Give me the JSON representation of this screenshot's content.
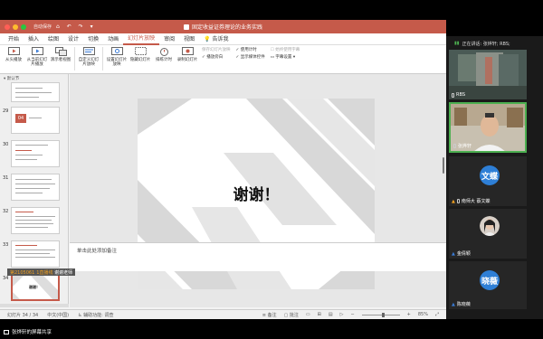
{
  "app": {
    "autosave_label": "自动保存",
    "doc_title": "固定收益证券理论的业务实践"
  },
  "menu": [
    "开始",
    "插入",
    "绘图",
    "设计",
    "切换",
    "动画",
    "幻灯片放映",
    "审阅",
    "视图",
    "告诉我"
  ],
  "ribbon": {
    "buttons": [
      "从头播放",
      "从当前幻灯片播放",
      "演示者视图",
      "自定义幻灯片放映",
      "设置幻灯片放映",
      "隐藏幻灯片",
      "排练计时",
      "录制幻灯片"
    ],
    "options_col1": [
      "保存幻灯片放映",
      "播放旁白"
    ],
    "options_col2": [
      "使用计时",
      "显示媒体控件"
    ],
    "options_col3": [
      "始终使用字幕",
      "字幕设置"
    ]
  },
  "thumbnails": {
    "section": "默认节",
    "numbers": [
      "29",
      "30",
      "31",
      "32",
      "33",
      "34"
    ],
    "label_29": "04"
  },
  "slide": {
    "title": "谢谢！"
  },
  "speaker_tip": {
    "prefix": "第2105061",
    "text": "1直播线",
    "name": "谢谢老师"
  },
  "notes": {
    "placeholder": "单击此处添加备注"
  },
  "status": {
    "slide_pos": "幻灯片 34 / 34",
    "language": "中文(中国)",
    "accessibility": "辅助功能: 调查",
    "notes_btn": "备注",
    "comments_btn": "批注",
    "zoom": "85%"
  },
  "meeting": {
    "speaking_label": "正在讲话: 张烨轩; RBS;",
    "participants": [
      {
        "name": "RBS"
      },
      {
        "name": "张烨轩"
      },
      {
        "name": "南师大 蔡文蝶",
        "avatar": "文蝶"
      },
      {
        "name": "金倩颖"
      },
      {
        "name": "陈晓薇",
        "avatar": "晓薇"
      }
    ],
    "avatar_color": "#2e7fd6"
  },
  "share_bar": {
    "label": "张烨轩的屏幕共享"
  },
  "colors": {
    "titlebar": "#c55a4a",
    "accent": "#c55a4a"
  }
}
